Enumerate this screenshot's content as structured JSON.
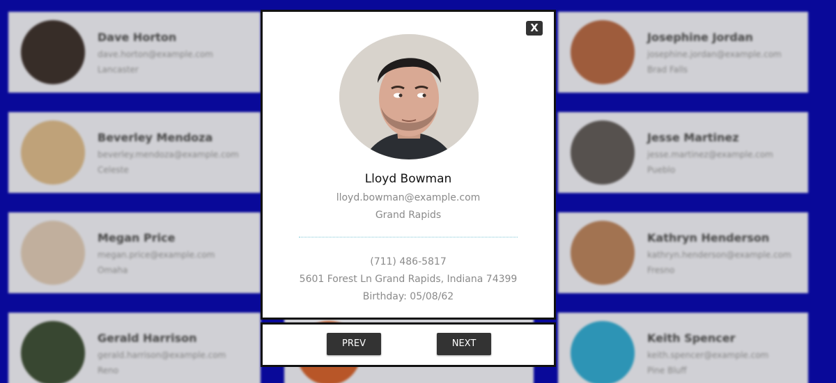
{
  "background_cards": [
    {
      "name": "Dave Horton",
      "email": "dave.horton@example.com",
      "city": "Lancaster",
      "avatar_color": "#3a2f2a"
    },
    {
      "name": "Josephine Jordan",
      "email": "josephine.jordan@example.com",
      "city": "Brad Falls",
      "avatar_color": "#a5603f"
    },
    {
      "name": "Beverley Mendoza",
      "email": "beverley.mendoza@example.com",
      "city": "Celeste",
      "avatar_color": "#c7a97e"
    },
    {
      "name": "Jesse Martinez",
      "email": "jesse.martinez@example.com",
      "city": "Pueblo",
      "avatar_color": "#5a5552"
    },
    {
      "name": "Megan Price",
      "email": "megan.price@example.com",
      "city": "Omaha",
      "avatar_color": "#c9b7a4"
    },
    {
      "name": "Kathryn Henderson",
      "email": "kathryn.henderson@example.com",
      "city": "Fresno",
      "avatar_color": "#a97855"
    },
    {
      "name": "Gerald Harrison",
      "email": "gerald.harrison@example.com",
      "city": "Reno",
      "avatar_color": "#3b4a33"
    },
    {
      "name": "Keith Spencer",
      "email": "keith.spencer@example.com",
      "city": "Pine Bluff",
      "avatar_color": "#2f9bbd"
    }
  ],
  "modal": {
    "close_label": "X",
    "name": "Lloyd Bowman",
    "email": "lloyd.bowman@example.com",
    "city": "Grand Rapids",
    "phone": "(711) 486-5817",
    "address": "5601 Forest Ln Grand Rapids, Indiana 74399",
    "birthday": "Birthday: 05/08/62"
  },
  "nav": {
    "prev_label": "PREV",
    "next_label": "NEXT"
  },
  "colors": {
    "page_background": "#0a0aa0",
    "button_dark": "#333333",
    "divider": "#7ec6d6"
  }
}
